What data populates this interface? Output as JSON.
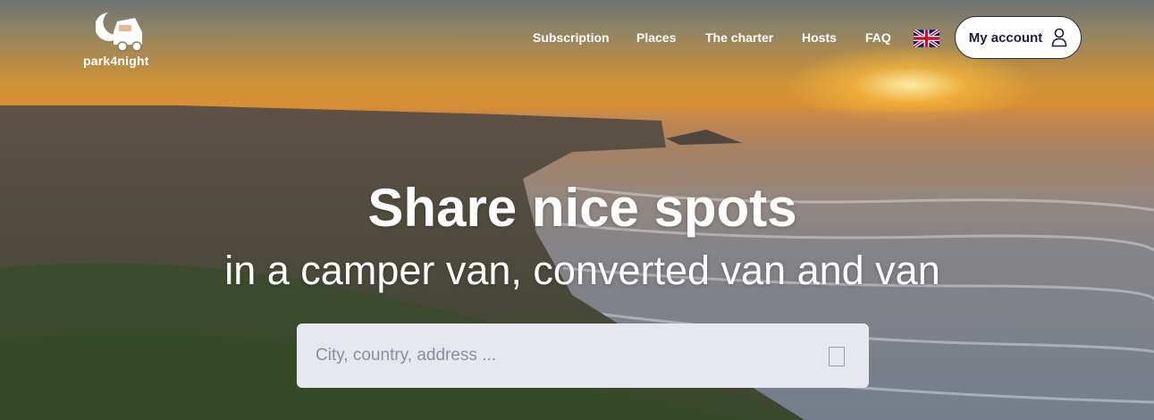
{
  "logo": {
    "text": "park4night",
    "icon": "camper-moon-logo-icon"
  },
  "nav": {
    "items": [
      {
        "label": "Subscription"
      },
      {
        "label": "Places"
      },
      {
        "label": "The charter"
      },
      {
        "label": "Hosts"
      },
      {
        "label": "FAQ"
      }
    ],
    "language_flag": "uk-flag-icon"
  },
  "account": {
    "label": "My account",
    "icon": "user-icon"
  },
  "hero": {
    "headline": "Share nice spots",
    "subline": "in a camper van, converted van and van"
  },
  "search": {
    "placeholder": "City, country, address ...",
    "button_icon": "search-submit-icon",
    "value": ""
  },
  "colors": {
    "sun": "#ffd27a",
    "sky": "#d98f35",
    "sea": "#7b7f85",
    "search_bg": "#e7e8ef",
    "account_text": "#1c1c3a"
  }
}
